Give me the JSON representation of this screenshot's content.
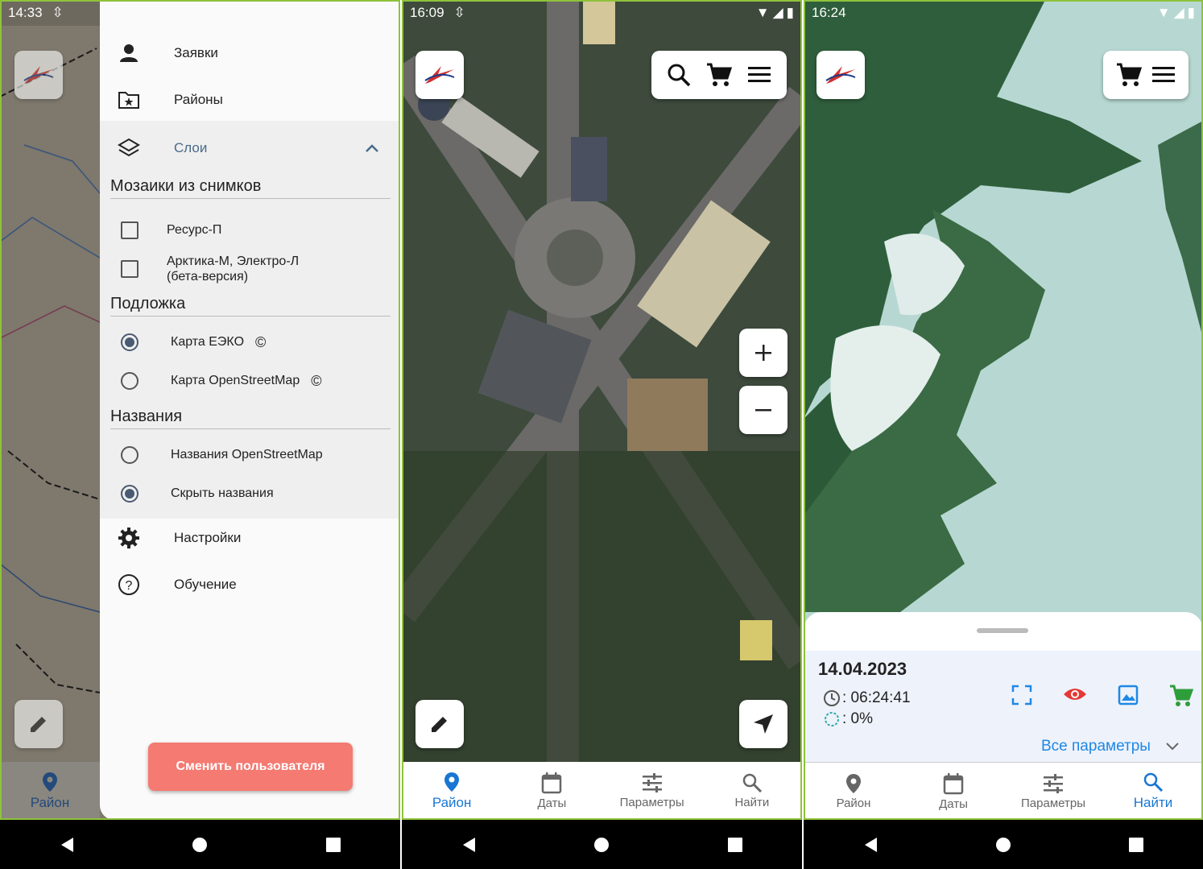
{
  "colors": {
    "accent": "#1976d2",
    "drawer_bg": "#fafafa",
    "button_red": "#f47a72",
    "border_green": "#8fc23c"
  },
  "screen1": {
    "status": {
      "time": "14:33"
    },
    "drawer": {
      "items": [
        {
          "label": "Заявки",
          "icon": "person-icon"
        },
        {
          "label": "Районы",
          "icon": "folder-star-icon"
        }
      ],
      "layers": {
        "label": "Слои",
        "mosaics": {
          "title": "Мозаики из снимков",
          "options": [
            {
              "label": "Ресурс-П",
              "checked": false
            },
            {
              "label": "Арктика-М, Электро-Л",
              "label2": "(бета-версия)",
              "checked": false
            }
          ]
        },
        "base": {
          "title": "Подложка",
          "options": [
            {
              "label": "Карта ЕЭКО",
              "suffix": "©",
              "selected": true
            },
            {
              "label": "Карта OpenStreetMap",
              "suffix": "©",
              "selected": false
            }
          ]
        },
        "names": {
          "title": "Названия",
          "options": [
            {
              "label": "Названия OpenStreetMap",
              "selected": false
            },
            {
              "label": "Скрыть названия",
              "selected": true
            }
          ]
        }
      },
      "settings": "Настройки",
      "tutorial": "Обучение",
      "switch_user": "Сменить пользователя"
    },
    "nav": {
      "district": "Район"
    }
  },
  "screen2": {
    "status": {
      "time": "16:09"
    },
    "nav": [
      {
        "label": "Район",
        "active": true
      },
      {
        "label": "Даты",
        "active": false
      },
      {
        "label": "Параметры",
        "active": false
      },
      {
        "label": "Найти",
        "active": false
      }
    ]
  },
  "screen3": {
    "status": {
      "time": "16:24"
    },
    "sheet": {
      "date": "14.04.2023",
      "time_value": ": 06:24:41",
      "cloud_value": ": 0%",
      "all_params": "Все параметры"
    },
    "nav": [
      {
        "label": "Район",
        "active": false
      },
      {
        "label": "Даты",
        "active": false
      },
      {
        "label": "Параметры",
        "active": false
      },
      {
        "label": "Найти",
        "active": true
      }
    ]
  }
}
